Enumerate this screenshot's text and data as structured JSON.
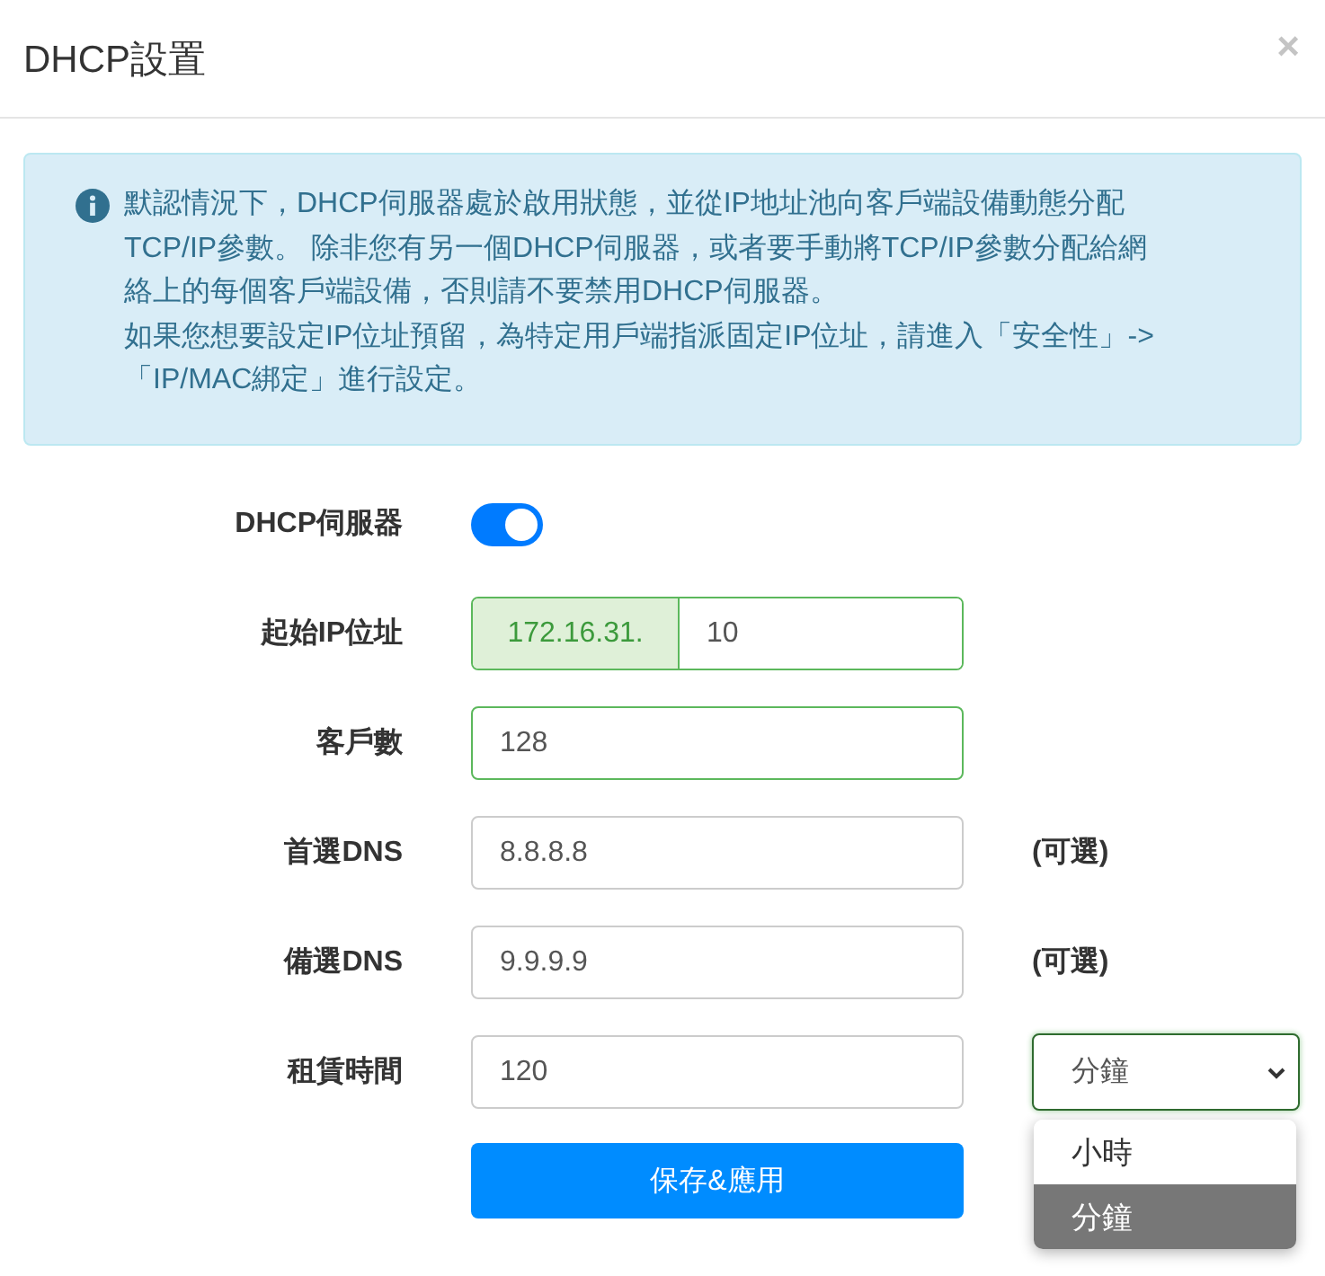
{
  "dialog": {
    "title": "DHCP設置",
    "close": "×"
  },
  "alert": {
    "lines": [
      "默認情況下，DHCP伺服器處於啟用狀態，並從IP地址池向客戶端設備動態分配",
      "TCP/IP參數。 除非您有另一個DHCP伺服器，或者要手動將TCP/IP參數分配給網",
      "絡上的每個客戶端設備，否則請不要禁用DHCP伺服器。",
      "如果您想要設定IP位址預留，為特定用戶端指派固定IP位址，請進入「安全性」->",
      "「IP/MAC綁定」進行設定。"
    ]
  },
  "form": {
    "rows": [
      {
        "kind": "switch",
        "label": "DHCP伺服器",
        "on": true
      },
      {
        "kind": "prefixed",
        "label": "起始IP位址",
        "prefix": "172.16.31.",
        "value": "10",
        "valid": true
      },
      {
        "kind": "input",
        "label": "客戶數",
        "value": "128",
        "valid": true
      },
      {
        "kind": "input",
        "label": "首選DNS",
        "value": "8.8.8.8",
        "valid": false,
        "note": "(可選)"
      },
      {
        "kind": "input",
        "label": "備選DNS",
        "value": "9.9.9.9",
        "valid": false,
        "note": "(可選)"
      },
      {
        "kind": "select",
        "label": "租賃時間",
        "value": "120",
        "valid": false,
        "select": {
          "value": "分鐘",
          "expanded": true,
          "options": [
            {
              "label": "小時",
              "selected": false
            },
            {
              "label": "分鐘",
              "selected": true
            }
          ]
        }
      }
    ],
    "submit": "保存&應用"
  }
}
